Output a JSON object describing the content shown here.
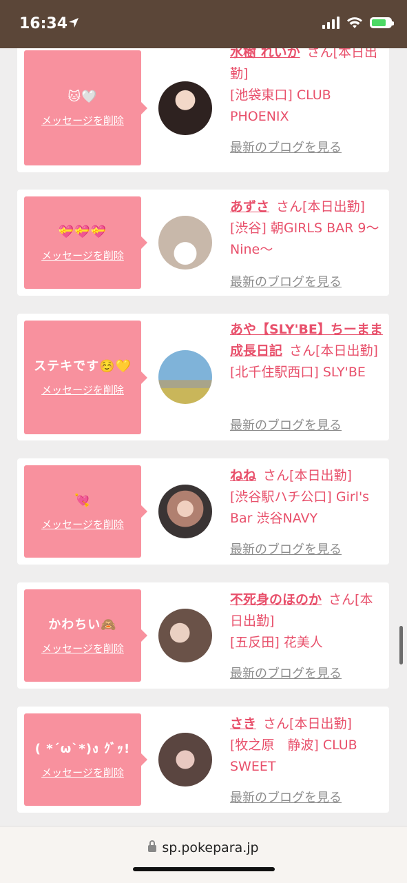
{
  "status": {
    "time": "16:34"
  },
  "browser": {
    "url": "sp.pokepara.jp"
  },
  "delete_label": "メッセージを削除",
  "blog_label": "最新のブログを見る",
  "san_suffix": "さん",
  "messages": [
    {
      "text": "🐱🤍",
      "name": "水樹 れいか",
      "status": "[本日出勤]",
      "shop": "[池袋東口] CLUB PHOENIX",
      "avatar_color": "#3a2a24"
    },
    {
      "text": "💝💝💝",
      "name": "あずさ",
      "status": "[本日出勤]",
      "shop": "[渋谷] 朝GIRLS BAR 9〜Nine〜",
      "avatar_color": "#d9cfc6"
    },
    {
      "text": "ステキです☺️💛",
      "name": "あや【SLY'BE】ちーまま成長日記",
      "status": "[本日出勤]",
      "shop": "[北千住駅西口] SLY'BE",
      "avatar_color": "#7fb3d9"
    },
    {
      "text": "💘",
      "name": "ねね",
      "status": "[本日出勤]",
      "shop": "[渋谷駅ハチ公口] Girl's Bar 渋谷NAVY",
      "avatar_color": "#9a7a6a"
    },
    {
      "text": "かわちい🙈",
      "name": "不死身のほのか",
      "status": "[本日出勤]",
      "shop": "[五反田] 花美人",
      "avatar_color": "#6a5a55"
    },
    {
      "text": "( *´ω`*)ง ｸﾞｯ!",
      "name": "さき",
      "status": "[本日出勤]",
      "shop": "[牧之原　静波] CLUB SWEET",
      "avatar_color": "#5a4540"
    }
  ]
}
